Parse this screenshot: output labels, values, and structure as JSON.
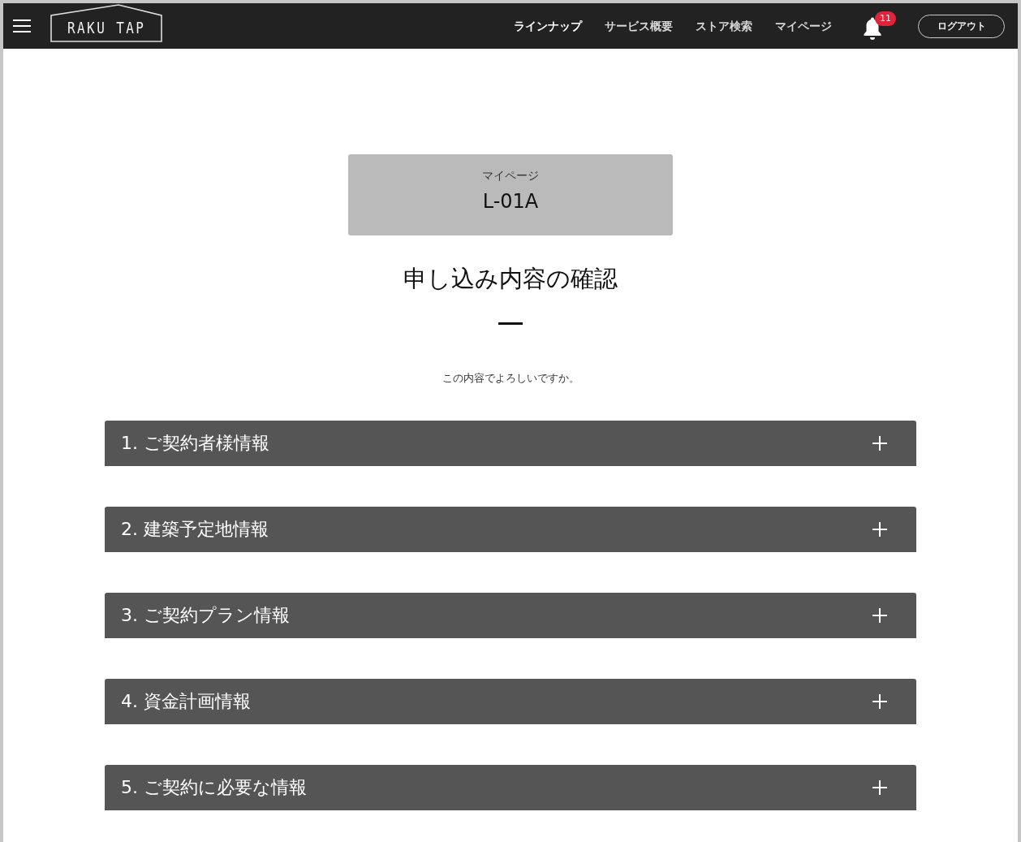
{
  "header": {
    "logo": "RAKU TAP",
    "nav": [
      {
        "label": "ラインナップ",
        "selected": true
      },
      {
        "label": "サービス概要",
        "selected": false
      },
      {
        "label": "ストア検索",
        "selected": false
      },
      {
        "label": "マイページ",
        "selected": false
      }
    ],
    "notification_count": "11",
    "logout": "ログアウト"
  },
  "page_card": {
    "label": "マイページ",
    "code": "L-01A"
  },
  "title": "申し込み内容の確認",
  "prompt": "この内容でよろしいですか。",
  "sections": [
    {
      "title": "1. ご契約者様情報",
      "expanded": false
    },
    {
      "title": "2. 建築予定地情報",
      "expanded": false
    },
    {
      "title": "3. ご契約プラン情報",
      "expanded": false
    },
    {
      "title": "4. 資金計画情報",
      "expanded": false
    },
    {
      "title": "5. ご契約に必要な情報",
      "expanded": false
    }
  ]
}
